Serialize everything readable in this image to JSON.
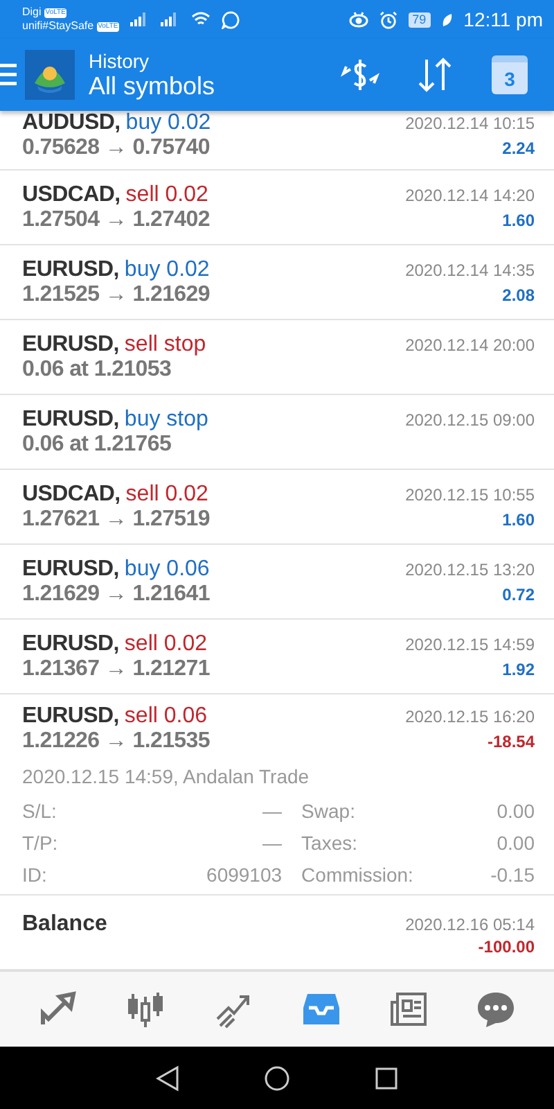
{
  "status_bar": {
    "carrier_1": "Digi",
    "carrier_2": "unifi#StaySafe",
    "volte_1": "VoLTE",
    "volte_2": "VoLTE",
    "battery": "79",
    "time": "12:11 pm"
  },
  "header": {
    "title": "History",
    "subtitle": "All symbols",
    "calendar_day": "3"
  },
  "rows": [
    {
      "kind": "deal",
      "symbol": "AUDUSD,",
      "action": "buy 0.02",
      "sell": false,
      "prices": "0.75628 → 0.75740",
      "time": "2020.12.14 10:15",
      "profit": "2.24",
      "loss": false
    },
    {
      "kind": "deal",
      "symbol": "USDCAD,",
      "action": "sell 0.02",
      "sell": true,
      "prices": "1.27504 → 1.27402",
      "time": "2020.12.14 14:20",
      "profit": "1.60",
      "loss": false
    },
    {
      "kind": "deal",
      "symbol": "EURUSD,",
      "action": "buy 0.02",
      "sell": false,
      "prices": "1.21525 → 1.21629",
      "time": "2020.12.14 14:35",
      "profit": "2.08",
      "loss": false
    },
    {
      "kind": "order",
      "symbol": "EURUSD,",
      "action": "sell stop",
      "sell": true,
      "prices": "0.06 at 1.21053",
      "time": "2020.12.14 20:00"
    },
    {
      "kind": "order",
      "symbol": "EURUSD,",
      "action": "buy stop",
      "sell": false,
      "prices": "0.06 at 1.21765",
      "time": "2020.12.15 09:00"
    },
    {
      "kind": "deal",
      "symbol": "USDCAD,",
      "action": "sell 0.02",
      "sell": true,
      "prices": "1.27621 → 1.27519",
      "time": "2020.12.15 10:55",
      "profit": "1.60",
      "loss": false
    },
    {
      "kind": "deal",
      "symbol": "EURUSD,",
      "action": "buy 0.06",
      "sell": false,
      "prices": "1.21629 → 1.21641",
      "time": "2020.12.15 13:20",
      "profit": "0.72",
      "loss": false
    },
    {
      "kind": "deal",
      "symbol": "EURUSD,",
      "action": "sell 0.02",
      "sell": true,
      "prices": "1.21367 → 1.21271",
      "time": "2020.12.15 14:59",
      "profit": "1.92",
      "loss": false
    },
    {
      "kind": "deal",
      "symbol": "EURUSD,",
      "action": "sell 0.06",
      "sell": true,
      "prices": "1.21226 → 1.21535",
      "time": "2020.12.15 16:20",
      "profit": "-18.54",
      "loss": true,
      "details": {
        "opened": "2020.12.15 14:59, Andalan Trade",
        "fields": [
          {
            "label": "S/L:",
            "value": "—",
            "label_2": "Swap:",
            "value_2": "0.00"
          },
          {
            "label": "T/P:",
            "value": "—",
            "label_2": "Taxes:",
            "value_2": "0.00"
          },
          {
            "label": "ID:",
            "value": "6099103",
            "label_2": "Commission:",
            "value_2": "-0.15"
          }
        ]
      }
    },
    {
      "kind": "balance",
      "symbol": "Balance",
      "time": "2020.12.16 05:14",
      "profit": "-100.00",
      "loss": true
    }
  ],
  "bottom_nav": [
    {
      "selected": false
    },
    {
      "selected": false
    },
    {
      "selected": false
    },
    {
      "selected": true
    },
    {
      "selected": false
    },
    {
      "selected": false
    }
  ]
}
